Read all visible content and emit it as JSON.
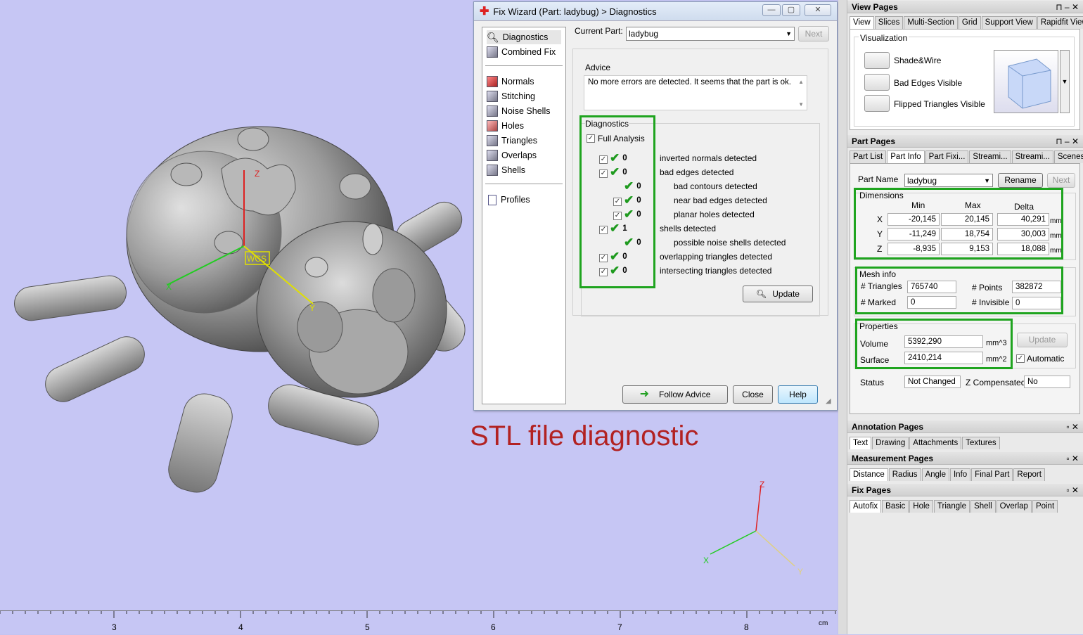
{
  "viewport": {
    "caption": "STL file diagnostic",
    "axis_labels": {
      "z": "Z",
      "x": "X",
      "y": "Y",
      "wcs": "WCS"
    },
    "ruler": {
      "ticks": [
        "3",
        "4",
        "5",
        "6",
        "7",
        "8"
      ],
      "unit": "cm"
    },
    "colors": {
      "background": "#c6c6f4",
      "x_axis": "#22cc22",
      "y_axis": "#e0e000",
      "z_axis": "#dd2222"
    }
  },
  "dialog": {
    "title": "Fix Wizard (Part: ladybug) > Diagnostics",
    "window_controls": [
      "minimize-icon",
      "maximize-icon",
      "close-icon"
    ],
    "nav": {
      "group1": [
        {
          "label": "Diagnostics",
          "icon": "magnifier-icon"
        },
        {
          "label": "Combined Fix",
          "icon": "cube-icon"
        }
      ],
      "group2": [
        {
          "label": "Normals",
          "icon": "cube-icon"
        },
        {
          "label": "Stitching",
          "icon": "cube-icon"
        },
        {
          "label": "Noise Shells",
          "icon": "cube-icon"
        },
        {
          "label": "Holes",
          "icon": "cube-icon"
        },
        {
          "label": "Triangles",
          "icon": "cube-icon"
        },
        {
          "label": "Overlaps",
          "icon": "cube-icon"
        },
        {
          "label": "Shells",
          "icon": "cube-icon"
        }
      ],
      "group3": [
        {
          "label": "Profiles",
          "icon": "document-icon"
        }
      ]
    },
    "current_part_label": "Current Part:",
    "current_part_value": "ladybug",
    "next_button": "Next",
    "advice": {
      "label": "Advice",
      "text": "No more errors are detected. It seems that the part is ok."
    },
    "diagnostics": {
      "label": "Diagnostics",
      "full_analysis": "Full Analysis",
      "rows": [
        {
          "count": "0",
          "text": "inverted normals detected",
          "checkbox": true,
          "indent": false
        },
        {
          "count": "0",
          "text": "bad edges detected",
          "checkbox": true,
          "indent": false
        },
        {
          "count": "0",
          "text": "bad contours detected",
          "checkbox": false,
          "indent": true
        },
        {
          "count": "0",
          "text": "near bad edges detected",
          "checkbox": true,
          "indent": true
        },
        {
          "count": "0",
          "text": "planar holes detected",
          "checkbox": true,
          "indent": true
        },
        {
          "count": "1",
          "text": "shells detected",
          "checkbox": true,
          "indent": false
        },
        {
          "count": "0",
          "text": "possible noise shells detected",
          "checkbox": false,
          "indent": true
        },
        {
          "count": "0",
          "text": "overlapping triangles detected",
          "checkbox": true,
          "indent": false
        },
        {
          "count": "0",
          "text": "intersecting triangles detected",
          "checkbox": true,
          "indent": false
        }
      ],
      "update_button": "Update"
    },
    "buttons": {
      "follow_advice": "Follow Advice",
      "close": "Close",
      "help": "Help"
    }
  },
  "view_pages": {
    "title": "View Pages",
    "tabs": [
      "View",
      "Slices",
      "Multi-Section",
      "Grid",
      "Support View",
      "Rapidfit View"
    ],
    "visualization_label": "Visualization",
    "options": [
      "Shade&Wire",
      "Bad Edges Visible",
      "Flipped Triangles Visible"
    ]
  },
  "part_pages": {
    "title": "Part Pages",
    "tabs": [
      "Part List",
      "Part Info",
      "Part Fixi...",
      "Streami...",
      "Streami...",
      "Scenes"
    ],
    "part_name_label": "Part Name",
    "part_name": "ladybug",
    "rename_button": "Rename",
    "next_button": "Next",
    "dimensions": {
      "label": "Dimensions",
      "headers": [
        "Min",
        "Max",
        "Delta"
      ],
      "rows": [
        {
          "axis": "X",
          "min": "-20,145",
          "max": "20,145",
          "delta": "40,291",
          "unit": "mm"
        },
        {
          "axis": "Y",
          "min": "-11,249",
          "max": "18,754",
          "delta": "30,003",
          "unit": "mm"
        },
        {
          "axis": "Z",
          "min": "-8,935",
          "max": "9,153",
          "delta": "18,088",
          "unit": "mm"
        }
      ]
    },
    "mesh_info": {
      "label": "Mesh info",
      "triangles_label": "# Triangles",
      "triangles": "765740",
      "points_label": "# Points",
      "points": "382872",
      "marked_label": "# Marked",
      "marked": "0",
      "invisible_label": "# Invisible",
      "invisible": "0"
    },
    "properties": {
      "label": "Properties",
      "volume_label": "Volume",
      "volume": "5392,290",
      "volume_unit": "mm^3",
      "surface_label": "Surface",
      "surface": "2410,214",
      "surface_unit": "mm^2",
      "update_button": "Update",
      "automatic_label": "Automatic"
    },
    "status_label": "Status",
    "status": "Not Changed",
    "z_comp_label": "Z Compensated",
    "z_comp": "No"
  },
  "annotation_pages": {
    "title": "Annotation Pages",
    "tabs": [
      "Text",
      "Drawing",
      "Attachments",
      "Textures"
    ]
  },
  "measurement_pages": {
    "title": "Measurement Pages",
    "tabs": [
      "Distance",
      "Radius",
      "Angle",
      "Info",
      "Final Part",
      "Report"
    ]
  },
  "fix_pages": {
    "title": "Fix Pages",
    "tabs": [
      "Autofix",
      "Basic",
      "Hole",
      "Triangle",
      "Shell",
      "Overlap",
      "Point"
    ]
  },
  "highlight_color": "#1fa41f"
}
